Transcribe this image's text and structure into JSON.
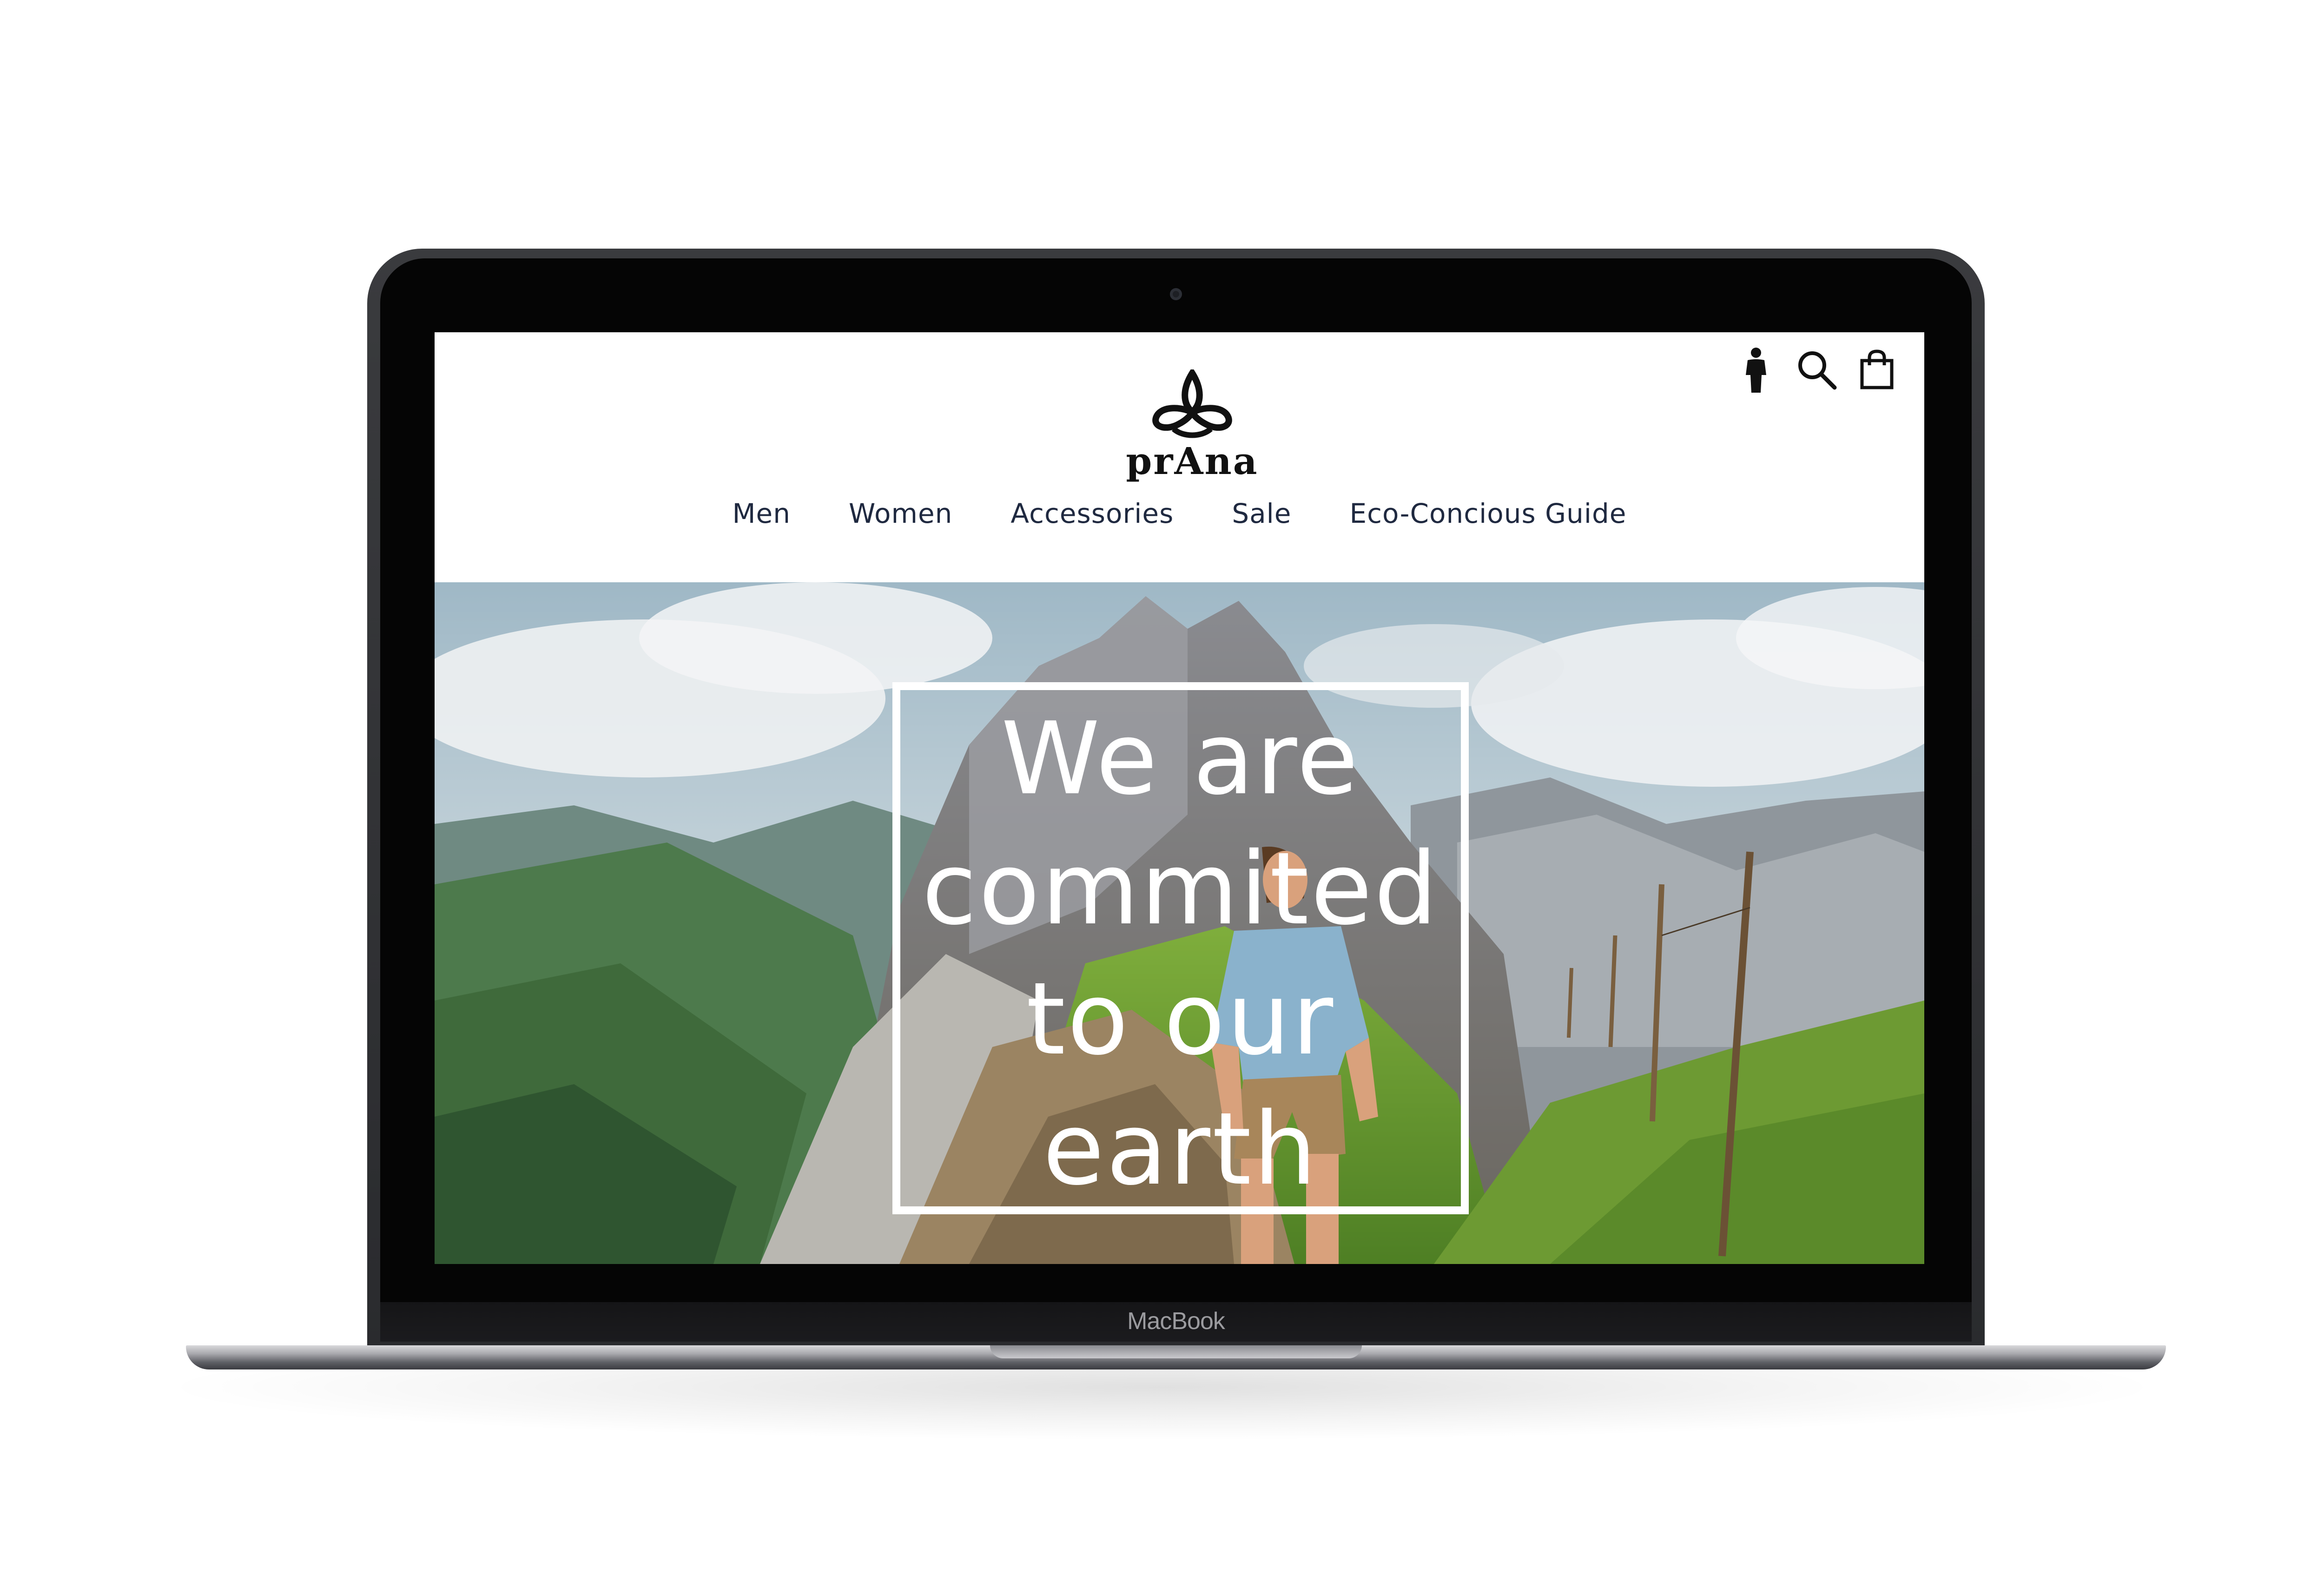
{
  "device": {
    "label": "MacBook"
  },
  "header": {
    "brand": "prAna",
    "icons": [
      "account-icon",
      "search-icon",
      "shopping-bag-icon"
    ]
  },
  "nav": {
    "items": [
      "Men",
      "Women",
      "Accessories",
      "Sale",
      "Eco-Concious Guide"
    ]
  },
  "hero": {
    "headline_lines": [
      "We are",
      "commited",
      "to our",
      "earth"
    ]
  },
  "colors": {
    "nav_text": "#1f2940",
    "hero_text": "#ffffff",
    "brand": "#111111"
  }
}
